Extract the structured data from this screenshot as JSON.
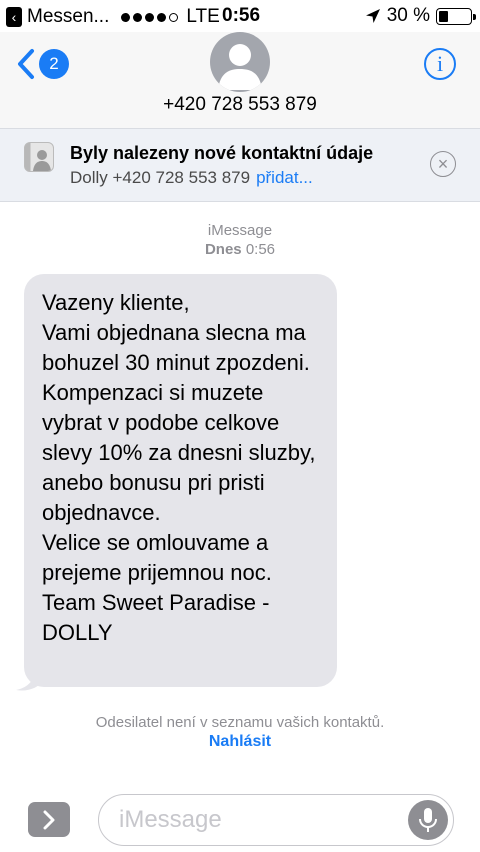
{
  "status_bar": {
    "back_app": "Messen...",
    "carrier": "LTE",
    "time": "0:56",
    "battery": "30 %",
    "battery_level": 0.3
  },
  "header": {
    "unread_count": "2",
    "contact_number": "+420 728 553 879"
  },
  "banner": {
    "title": "Byly nalezeny nové kontaktní údaje",
    "subtitle": "Dolly +420 728 553 879",
    "add_label": "přidat..."
  },
  "thread": {
    "service": "iMessage",
    "day": "Dnes",
    "time": "0:56",
    "message": "Vazeny kliente,\nVami objednana slecna ma bohuzel 30 minut zpozdeni. Kompenzaci si muzete vybrat v podobe celkove slevy 10% za dnesni sluzby, anebo bonusu pri pristi objednavce.\nVelice se omlouvame a prejeme prijemnou noc.\nTeam Sweet Paradise - DOLLY",
    "unknown_sender_notice": "Odesilatel není v seznamu vašich kontaktů.",
    "report_label": "Nahlásit"
  },
  "input": {
    "placeholder": "iMessage"
  },
  "icons": {
    "back": "chevron-left-icon",
    "info": "info-icon",
    "close": "close-circle-icon",
    "location": "location-arrow-icon",
    "mic": "microphone-icon",
    "apps": "chevron-right-icon"
  },
  "colors": {
    "accent": "#1a7cf5",
    "bubble": "#e5e5ea",
    "muted": "#8e8e93"
  }
}
